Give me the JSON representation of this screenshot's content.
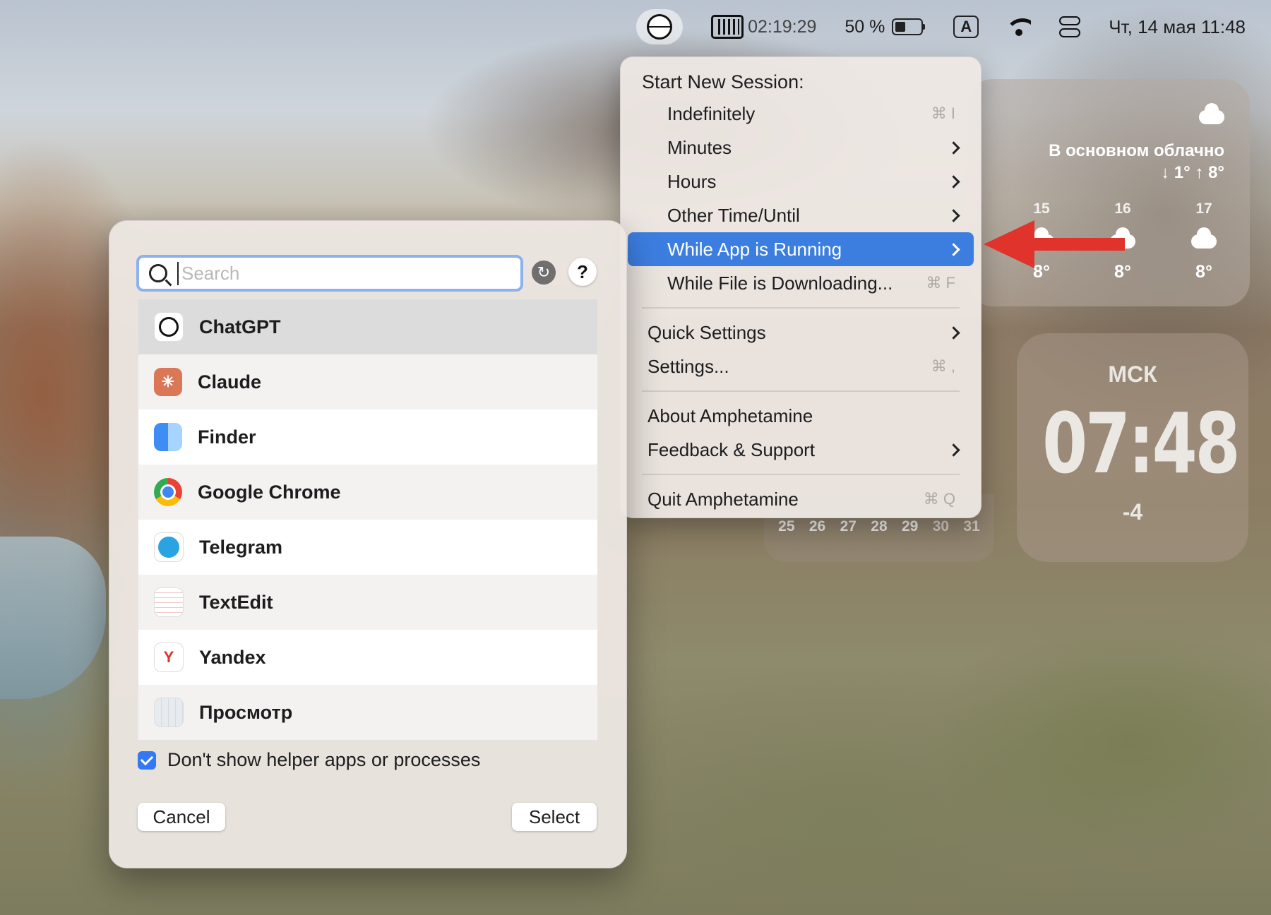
{
  "menubar": {
    "timer": "02:19:29",
    "battery": "50 %",
    "input_source": "A",
    "datetime": "Чт, 14 мая  11:48"
  },
  "weather": {
    "condition": "В основном облачно",
    "range": "↓ 1° ↑ 8°",
    "hours": [
      {
        "hour": "15",
        "temp": "8°"
      },
      {
        "hour": "16",
        "temp": "8°"
      },
      {
        "hour": "17",
        "temp": "8°"
      }
    ]
  },
  "clock": {
    "city": "МСК",
    "time": "07:48",
    "offset": "-4"
  },
  "calendar": {
    "days": [
      "25",
      "26",
      "27",
      "28",
      "29",
      "30",
      "31"
    ]
  },
  "menu": {
    "header": "Start New Session:",
    "session_items": [
      {
        "label": "Indefinitely",
        "shortcut": "⌘ I"
      },
      {
        "label": "Minutes"
      },
      {
        "label": "Hours"
      },
      {
        "label": "Other Time/Until"
      },
      {
        "label": "While App is Running"
      },
      {
        "label": "While File is Downloading...",
        "shortcut": "⌘ F"
      }
    ],
    "quick_settings": "Quick Settings",
    "settings": {
      "label": "Settings...",
      "shortcut": "⌘ ,"
    },
    "about": "About Amphetamine",
    "feedback": "Feedback & Support",
    "quit": {
      "label": "Quit Amphetamine",
      "shortcut": "⌘ Q"
    }
  },
  "dialog": {
    "search_placeholder": "Search",
    "refresh_glyph": "↻",
    "help_label": "?",
    "apps": [
      {
        "name": "ChatGPT",
        "icon": "chatgpt-icon"
      },
      {
        "name": "Claude",
        "icon": "claude-icon",
        "glyph": "✳"
      },
      {
        "name": "Finder",
        "icon": "finder-icon"
      },
      {
        "name": "Google Chrome",
        "icon": "chrome-icon"
      },
      {
        "name": "Telegram",
        "icon": "telegram-icon"
      },
      {
        "name": "TextEdit",
        "icon": "textedit-icon"
      },
      {
        "name": "Yandex",
        "icon": "yandex-icon",
        "glyph": "Y"
      },
      {
        "name": "Просмотр",
        "icon": "preview-icon"
      }
    ],
    "checkbox_label": "Don't show helper apps or processes",
    "cancel_label": "Cancel",
    "select_label": "Select"
  },
  "colors": {
    "menu_highlight": "#3c7ee0",
    "arrow": "#e0332b",
    "checkbox": "#3478f6"
  }
}
